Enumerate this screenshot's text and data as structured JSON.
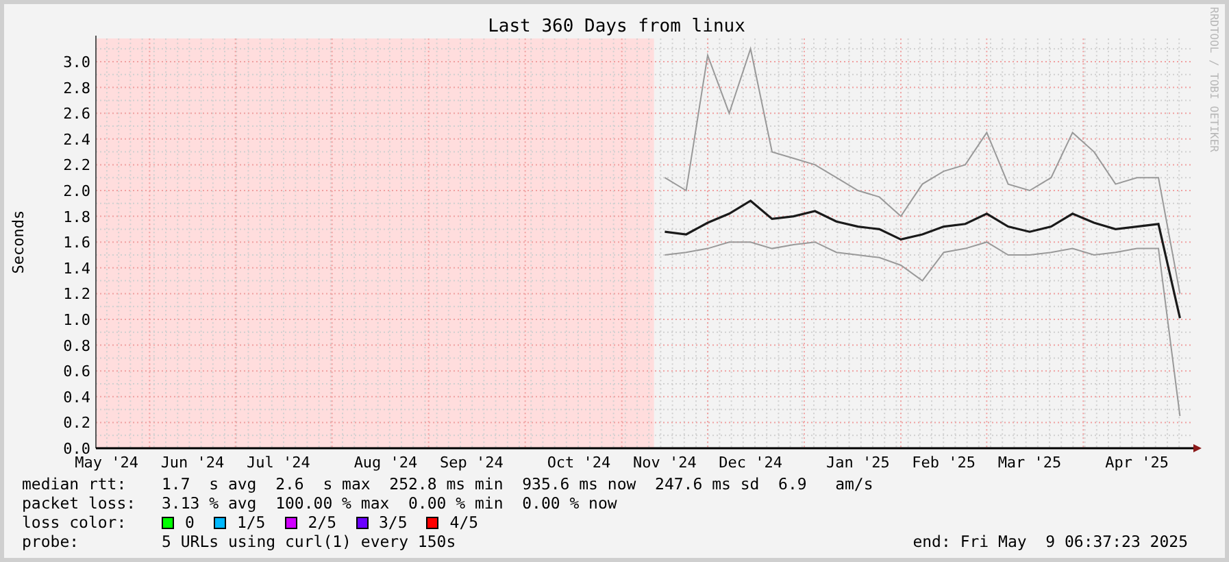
{
  "graph": {
    "title": "Last 360 Days from linux",
    "credit": "RRDTOOL / TOBI OETIKER",
    "chart_data": {
      "type": "line",
      "ylabel": "Seconds",
      "ylim": [
        0,
        3.18
      ],
      "grid": true,
      "categories": [
        "May '24",
        null,
        null,
        null,
        "Jun '24",
        null,
        null,
        null,
        "Jul '24",
        null,
        null,
        null,
        null,
        "Aug '24",
        null,
        null,
        null,
        "Sep '24",
        null,
        null,
        null,
        null,
        "Oct '24",
        null,
        null,
        null,
        "Nov '24",
        null,
        null,
        null,
        "Dec '24",
        null,
        null,
        null,
        null,
        "Jan '25",
        null,
        null,
        null,
        "Feb '25",
        null,
        null,
        null,
        "Mar '25",
        null,
        null,
        null,
        null,
        "Apr '25",
        null,
        null
      ],
      "yticks": [
        {
          "value": 0,
          "label": "0.0"
        },
        {
          "value": 0.2,
          "label": "0.2"
        },
        {
          "value": 0.4,
          "label": "0.4"
        },
        {
          "value": 0.6,
          "label": "0.6"
        },
        {
          "value": 0.8,
          "label": "0.8"
        },
        {
          "value": 1.0,
          "label": "1.0"
        },
        {
          "value": 1.2,
          "label": "1.2"
        },
        {
          "value": 1.4,
          "label": "1.4"
        },
        {
          "value": 1.6,
          "label": "1.6"
        },
        {
          "value": 1.8,
          "label": "1.8"
        },
        {
          "value": 2.0,
          "label": "2.0"
        },
        {
          "value": 2.2,
          "label": "2.2"
        },
        {
          "value": 2.4,
          "label": "2.4"
        },
        {
          "value": 2.6,
          "label": "2.6"
        },
        {
          "value": 2.8,
          "label": "2.8"
        },
        {
          "value": 3.0,
          "label": "3.0"
        }
      ],
      "series": [
        {
          "color": "#999999",
          "values": [
            null,
            null,
            null,
            null,
            null,
            null,
            null,
            null,
            null,
            null,
            null,
            null,
            null,
            null,
            null,
            null,
            null,
            null,
            null,
            null,
            null,
            null,
            null,
            null,
            null,
            null,
            2.1,
            2.0,
            3.05,
            2.6,
            3.1,
            2.3,
            2.25,
            2.2,
            2.1,
            2.0,
            1.95,
            1.8,
            2.05,
            2.15,
            2.2,
            2.45,
            2.05,
            2.0,
            2.1,
            2.45,
            2.3,
            2.05,
            2.1,
            2.1,
            1.2
          ]
        },
        {
          "color": "#999999",
          "values": [
            null,
            null,
            null,
            null,
            null,
            null,
            null,
            null,
            null,
            null,
            null,
            null,
            null,
            null,
            null,
            null,
            null,
            null,
            null,
            null,
            null,
            null,
            null,
            null,
            null,
            null,
            1.5,
            1.52,
            1.55,
            1.6,
            1.6,
            1.55,
            1.58,
            1.6,
            1.52,
            1.5,
            1.48,
            1.42,
            1.3,
            1.52,
            1.55,
            1.6,
            1.5,
            1.5,
            1.52,
            1.55,
            1.5,
            1.52,
            1.55,
            1.55,
            0.25
          ]
        },
        {
          "color": "#1a1a1a",
          "values": [
            null,
            null,
            null,
            null,
            null,
            null,
            null,
            null,
            null,
            null,
            null,
            null,
            null,
            null,
            null,
            null,
            null,
            null,
            null,
            null,
            null,
            null,
            null,
            null,
            null,
            null,
            1.68,
            1.66,
            1.75,
            1.82,
            1.92,
            1.78,
            1.8,
            1.84,
            1.76,
            1.72,
            1.7,
            1.62,
            1.66,
            1.72,
            1.74,
            1.82,
            1.72,
            1.68,
            1.72,
            1.82,
            1.75,
            1.7,
            1.72,
            1.74,
            1.01
          ]
        }
      ]
    }
  },
  "legend": {
    "rows": [
      {
        "kind": "text",
        "label": "median rtt:",
        "text": "1.7  s avg  2.6  s max  252.8 ms min  935.6 ms now  247.6 ms sd  6.9   am/s"
      },
      {
        "kind": "text",
        "label": "packet loss:",
        "text": "3.13 % avg  100.00 % max  0.00 % min  0.00 % now"
      },
      {
        "kind": "colors",
        "label": "loss color:",
        "items": [
          {
            "label": "0",
            "color": "#00ff00"
          },
          {
            "label": "1/5",
            "color": "#00b8ff"
          },
          {
            "label": "2/5",
            "color": "#d000ff"
          },
          {
            "label": "3/5",
            "color": "#6a00ff"
          },
          {
            "label": "4/5",
            "color": "#ff0000"
          }
        ]
      },
      {
        "kind": "probe",
        "label": "probe:",
        "text": "5 URLs using curl(1) every 150s",
        "end": "end: Fri May  9 06:37:23 2025"
      }
    ]
  }
}
